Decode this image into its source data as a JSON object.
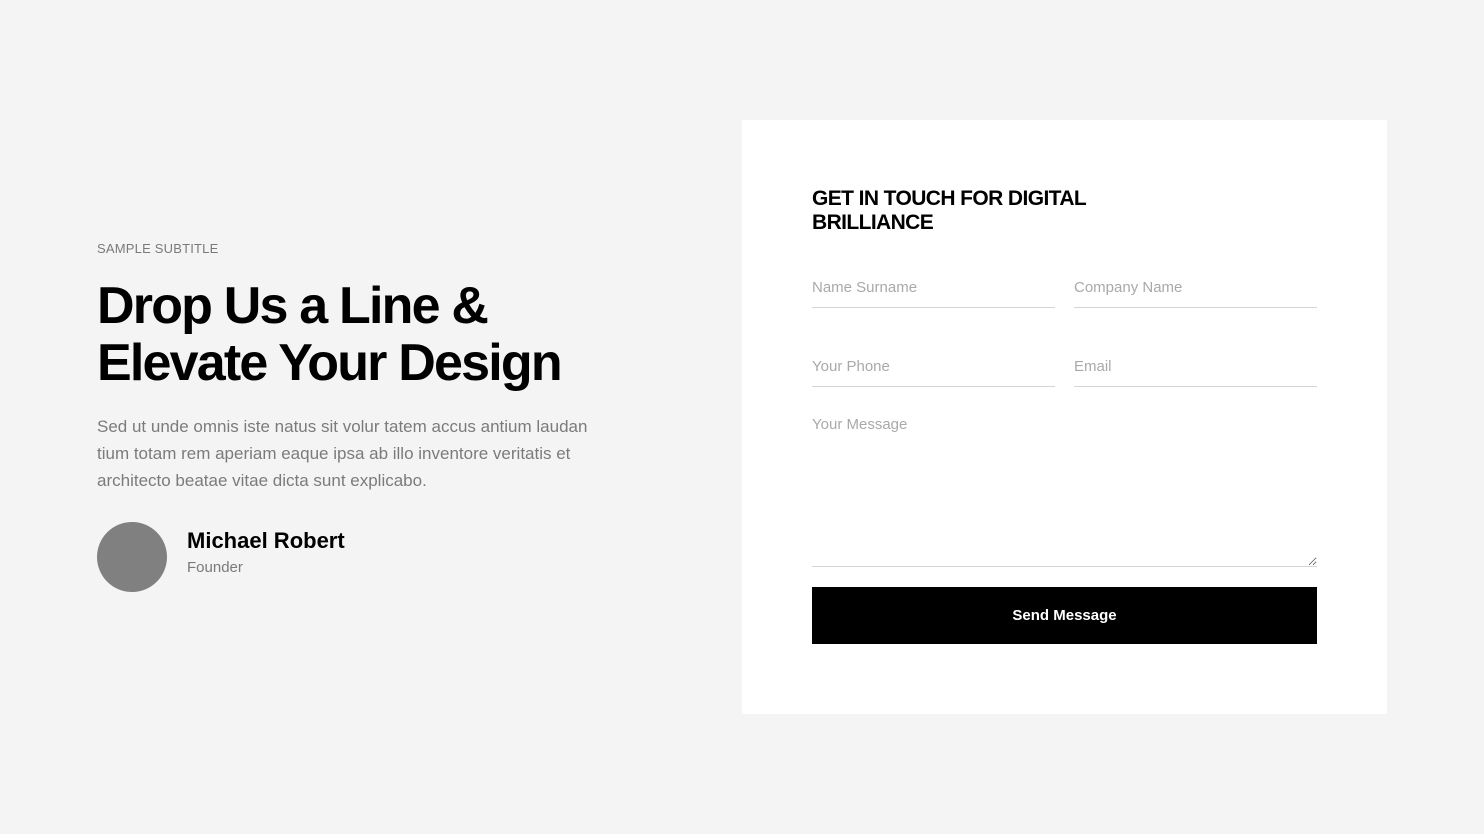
{
  "intro": {
    "subtitle": "SAMPLE SUBTITLE",
    "headline_line1": "Drop Us a Line &",
    "headline_line2": "Elevate Your Design",
    "body_line1": "Sed ut unde omnis iste natus sit volur tatem accus antium laudan",
    "body_line2": "tium totam rem aperiam eaque ipsa ab illo inventore veritatis et",
    "body_line3": "architecto beatae vitae dicta sunt explicabo."
  },
  "author": {
    "name": "Michael Robert",
    "role": "Founder"
  },
  "form": {
    "title_line1": "GET IN TOUCH FOR DIGITAL",
    "title_line2": "BRILLIANCE",
    "name_placeholder": "Name Surname",
    "company_placeholder": "Company Name",
    "phone_placeholder": "Your Phone",
    "email_placeholder": "Email",
    "message_placeholder": "Your Message",
    "name_value": "",
    "company_value": "",
    "phone_value": "",
    "email_value": "",
    "message_value": "",
    "submit_label": "Send Message"
  },
  "colors": {
    "page_background": "#f4f4f4",
    "card_background": "#ffffff",
    "button_background": "#000000",
    "button_text": "#ffffff",
    "muted_text": "#7b7b7b",
    "avatar": "#808080"
  }
}
